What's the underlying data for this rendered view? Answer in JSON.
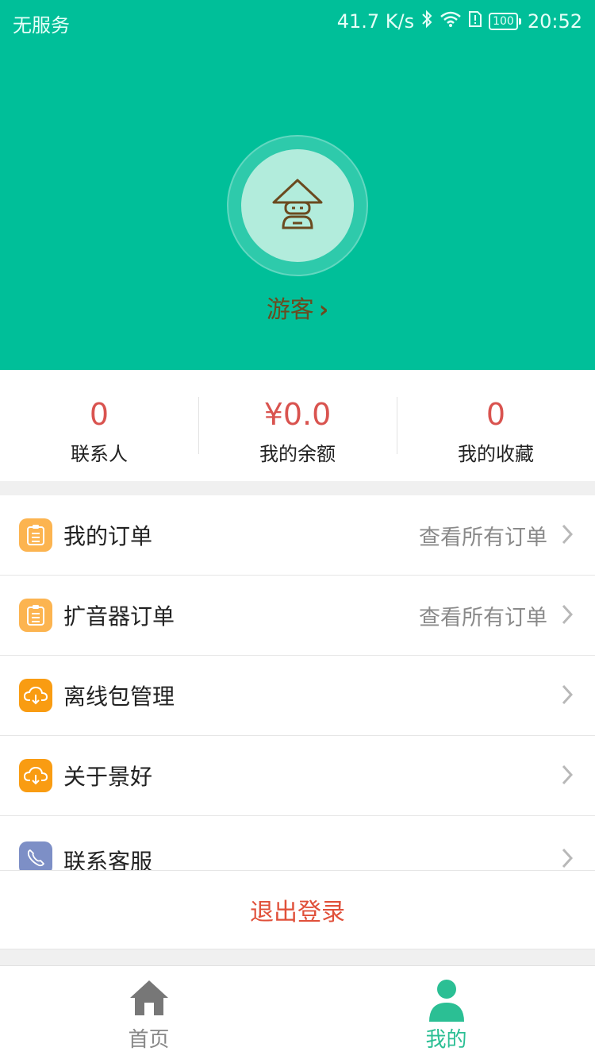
{
  "status_bar": {
    "carrier": "无服务",
    "speed": "41.7 K/s",
    "battery": "100",
    "time": "20:52"
  },
  "profile": {
    "name": "游客",
    "chevron": "›"
  },
  "stats": [
    {
      "value": "0",
      "label": "联系人"
    },
    {
      "value": "¥0.0",
      "label": "我的余额"
    },
    {
      "value": "0",
      "label": "我的收藏"
    }
  ],
  "menu": [
    {
      "label": "我的订单",
      "right": "查看所有订单",
      "icon": "clipboard-icon"
    },
    {
      "label": "扩音器订单",
      "right": "查看所有订单",
      "icon": "clipboard-icon"
    },
    {
      "label": "离线包管理",
      "right": "",
      "icon": "cloud-download-icon"
    },
    {
      "label": "关于景好",
      "right": "",
      "icon": "cloud-download-icon"
    },
    {
      "label": "联系客服",
      "right": "",
      "icon": "phone-icon"
    }
  ],
  "logout": "退出登录",
  "tabs": [
    {
      "label": "首页",
      "icon": "home-icon"
    },
    {
      "label": "我的",
      "icon": "user-icon"
    }
  ],
  "colors": {
    "header": "#00bf99",
    "accent": "#2bbf94",
    "value_red": "#d9534f",
    "logout_red": "#e0503a",
    "orange_icon": "#fcb450",
    "orange_icon_dark": "#f99c12",
    "blue_icon": "#7d8fc6"
  }
}
